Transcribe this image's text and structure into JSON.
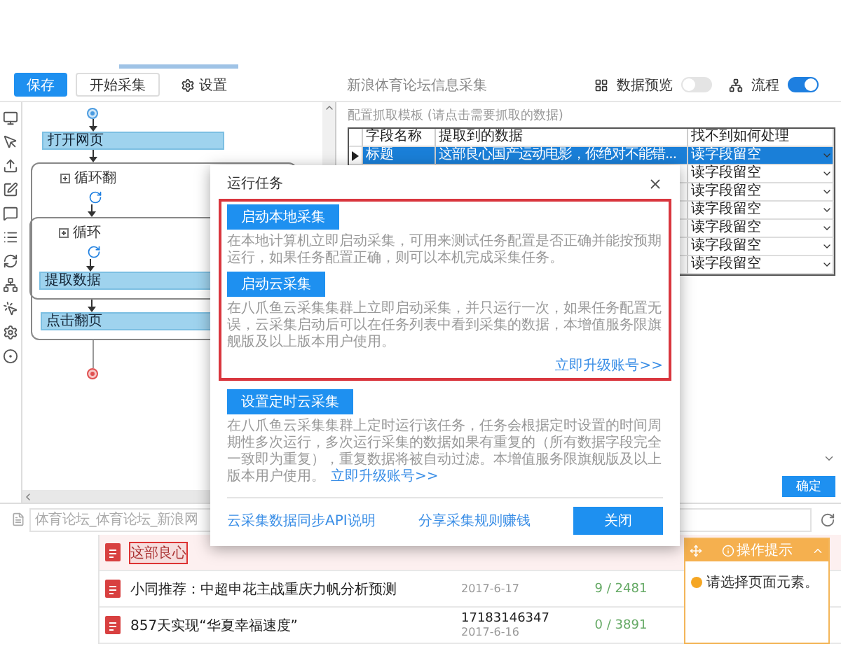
{
  "toolbar": {
    "buttons": [
      {
        "label": "保存",
        "kind": "primary"
      },
      {
        "label": "开始采集",
        "kind": "outline"
      },
      {
        "label": "设置",
        "kind": "settings"
      }
    ],
    "title": "新浪体育论坛信息采集",
    "toggles": [
      {
        "label": "数据预览",
        "on": false,
        "kind": "grid"
      },
      {
        "label": "流程",
        "on": true,
        "kind": "flow"
      }
    ]
  },
  "flow": {
    "steps": [
      {
        "kind": "action",
        "label": "打开网页"
      },
      {
        "kind": "loop",
        "label": "循环翻",
        "children": [
          {
            "kind": "loop",
            "label": "循环",
            "children": [
              {
                "kind": "action",
                "label": "提取数据"
              }
            ]
          },
          {
            "kind": "action",
            "label": "点击翻页"
          }
        ]
      }
    ]
  },
  "template": {
    "caption": "配置抓取模板 (请点击需要抓取的数据)",
    "columns": [
      "字段名称",
      "提取到的数据",
      "找不到如何处理"
    ],
    "rows": [
      {
        "field": "标题",
        "data": "这部良心国产运动电影，你绝对不能错...",
        "fallback": "读字段留空",
        "selected": true
      },
      {
        "fallback": "读字段留空",
        "selected": false
      },
      {
        "fallback": "读字段留空",
        "selected": false
      },
      {
        "fallback": "读字段留空",
        "selected": false
      },
      {
        "fallback": "读字段留空",
        "selected": false
      },
      {
        "fallback": "读字段留空",
        "selected": false
      },
      {
        "fallback": "读字段留空",
        "selected": false
      }
    ],
    "confirm": "确定"
  },
  "address": {
    "placeholder": "体育论坛_体育论坛_新浪网"
  },
  "list": {
    "rows": [
      {
        "title": "这部良心",
        "highlighted": true
      },
      {
        "title": "小同推荐：中超申花主战重庆力帆分析预测",
        "highlighted": false,
        "date": "2017-6-17",
        "count": "9 / 2481"
      },
      {
        "title": "857天实现“华夏幸福速度”",
        "highlighted": false,
        "number": "17183146347",
        "date": "2017-6-16",
        "count": "0 / 3891"
      }
    ]
  },
  "hint": {
    "title": "操作提示",
    "message": "请选择页面元素。"
  },
  "dialog": {
    "title": "运行任务",
    "options": [
      {
        "button": "启动本地采集",
        "description": "在本地计算机立即启动采集，可用来测试任务配置是否正确并能按预期运行，如果任务配置正确，则可以本机完成采集任务。",
        "highlighted": true
      },
      {
        "button": "启动云采集",
        "description": "在八爪鱼云采集集群上立即启动采集，并只运行一次，如果任务配置无误，云采集启动后可以在任务列表中看到采集的数据，本增值服务限旗舰版及以上版本用户使用。",
        "link": "立即升级账号>>",
        "highlighted": true
      },
      {
        "button": "设置定时云采集",
        "description": "在八爪鱼云采集集群上定时运行该任务，任务会根据定时设置的时间周期性多次运行，多次运行采集的数据如果有重复的（所有数据字段完全一致即为重复），重复数据将被自动过滤。本增值服务限旗舰版及以上版本用户使用。",
        "link": "立即升级账号>>",
        "highlighted": false
      }
    ],
    "footer_links": [
      "云采集数据同步API说明",
      "分享采集规则赚钱"
    ],
    "close": "关闭"
  }
}
